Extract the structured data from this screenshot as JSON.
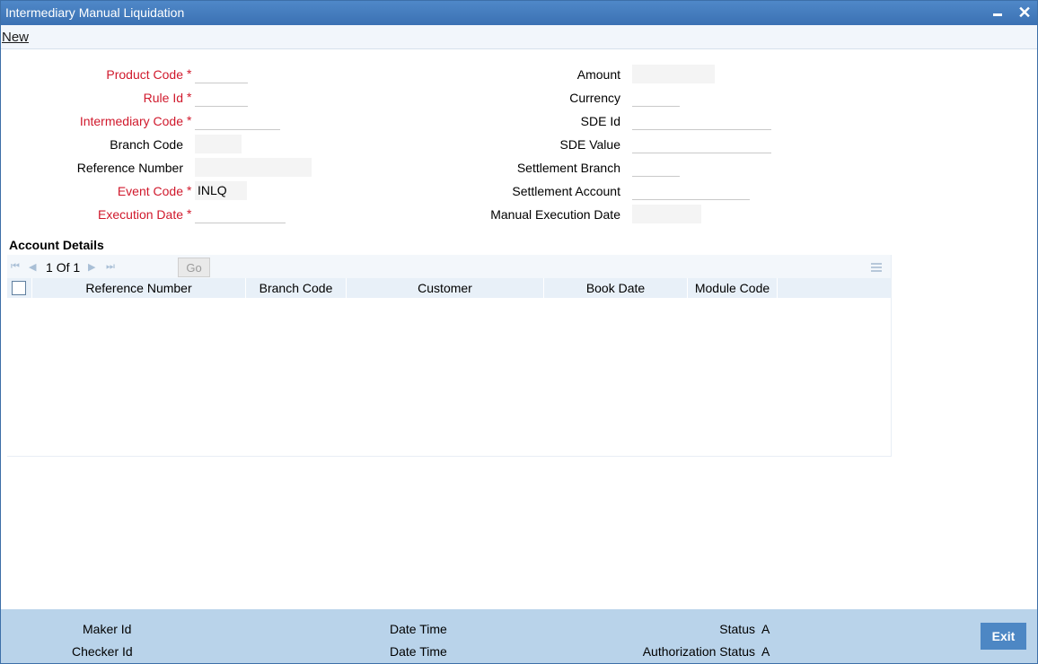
{
  "window": {
    "title": "Intermediary Manual Liquidation",
    "minimize_icon": "minimize-icon",
    "close_glyph": "✕"
  },
  "menu": {
    "new_label": "New"
  },
  "form": {
    "product_code_label": "Product Code",
    "rule_id_label": "Rule Id",
    "intermediary_code_label": "Intermediary Code",
    "branch_code_label": "Branch Code",
    "reference_number_label": "Reference Number",
    "event_code_label": "Event Code",
    "event_code_value": "INLQ",
    "execution_date_label": "Execution Date",
    "amount_label": "Amount",
    "currency_label": "Currency",
    "sde_id_label": "SDE Id",
    "sde_value_label": "SDE Value",
    "settlement_branch_label": "Settlement Branch",
    "settlement_account_label": "Settlement Account",
    "manual_execution_date_label": "Manual Execution Date",
    "required_marker": "*"
  },
  "account_details": {
    "title": "Account Details",
    "pager": {
      "current": "1",
      "of_label": "Of",
      "total": "1",
      "go_label": "Go"
    },
    "columns": [
      "Reference Number",
      "Branch Code",
      "Customer",
      "Book Date",
      "Module Code"
    ],
    "rows": []
  },
  "footer": {
    "maker_id_label": "Maker Id",
    "checker_id_label": "Checker Id",
    "date_time_label_1": "Date Time",
    "date_time_label_2": "Date Time",
    "status_label": "Status",
    "status_value": "A",
    "auth_status_label": "Authorization Status",
    "auth_status_value": "A",
    "exit_label": "Exit"
  },
  "colors": {
    "titlebar": "#3b71b3",
    "required": "#d0192c",
    "footer": "#b9d3ea",
    "exit_button": "#4d87c4"
  }
}
